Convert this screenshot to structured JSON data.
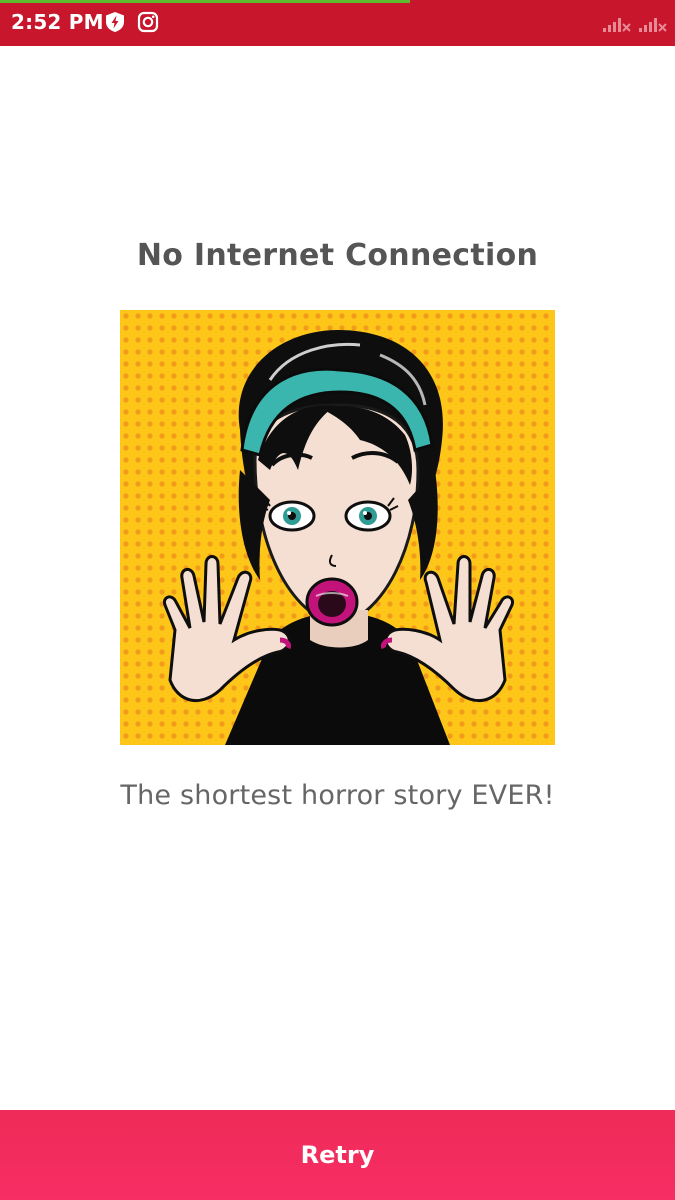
{
  "status_bar": {
    "time": "2:52 PM",
    "icons": [
      "shield-lightning-icon",
      "instagram-icon",
      "signal-off-icon",
      "signal-off-icon"
    ],
    "background": "#c8162c"
  },
  "main": {
    "title": "No Internet Connection",
    "illustration": "pop-art-shocked-woman-illustration",
    "subtitle": "The shortest horror story EVER!"
  },
  "retry_button": {
    "label": "Retry",
    "color": "#f22c5f"
  }
}
